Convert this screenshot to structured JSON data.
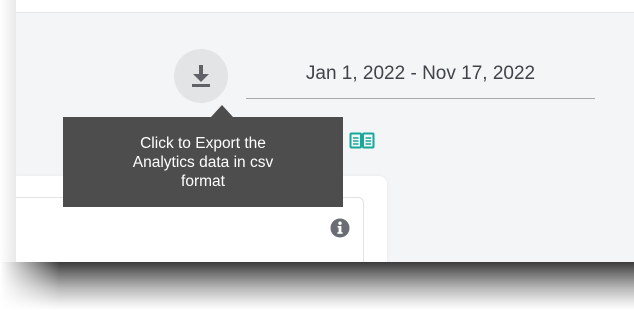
{
  "export": {
    "icon": "download-icon",
    "tooltip_lines": [
      "Click to Export the",
      "Analytics data in csv",
      "format"
    ]
  },
  "date_filter": {
    "value": "Jan 1, 2022 - Nov 17, 2022"
  },
  "guide": {
    "icon": "book-icon",
    "color": "#16a99a"
  },
  "card": {
    "info_icon": "info-icon"
  },
  "colors": {
    "background": "#f4f5f7",
    "tooltip": "#4d4d4d",
    "icon_button": "#e3e4e6",
    "accent": "#16a99a"
  }
}
